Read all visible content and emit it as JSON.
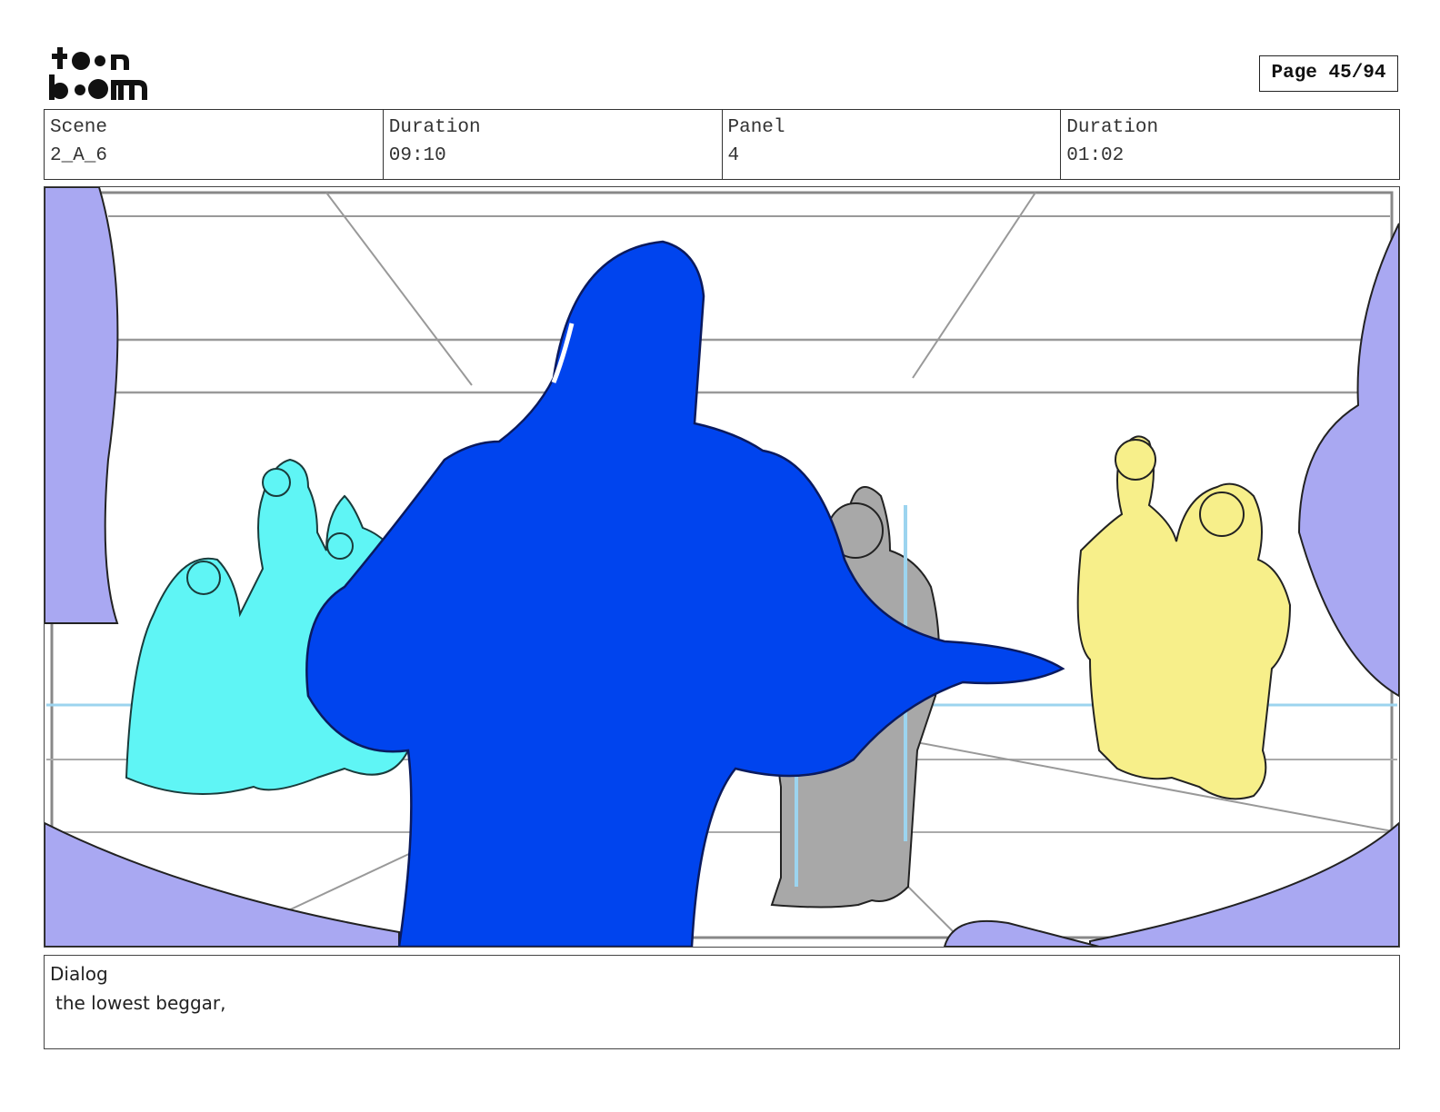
{
  "brand": {
    "logo_line1": "toon",
    "logo_line2": "boom"
  },
  "page": {
    "label": "Page 45/94"
  },
  "header": {
    "scene_label": "Scene",
    "scene_value": "2_A_6",
    "scene_duration_label": "Duration",
    "scene_duration_value": "09:10",
    "panel_label": "Panel",
    "panel_value": "4",
    "panel_duration_label": "Duration",
    "panel_duration_value": "01:02"
  },
  "dialog": {
    "label": "Dialog",
    "text": "the lowest beggar,"
  },
  "colors": {
    "frame_lavender": "#a9a8f2",
    "hero_blue": "#0044ee",
    "group_cyan": "#5ff5f5",
    "figure_gray": "#a8a8a8",
    "group_yellow": "#f7ef8a"
  }
}
